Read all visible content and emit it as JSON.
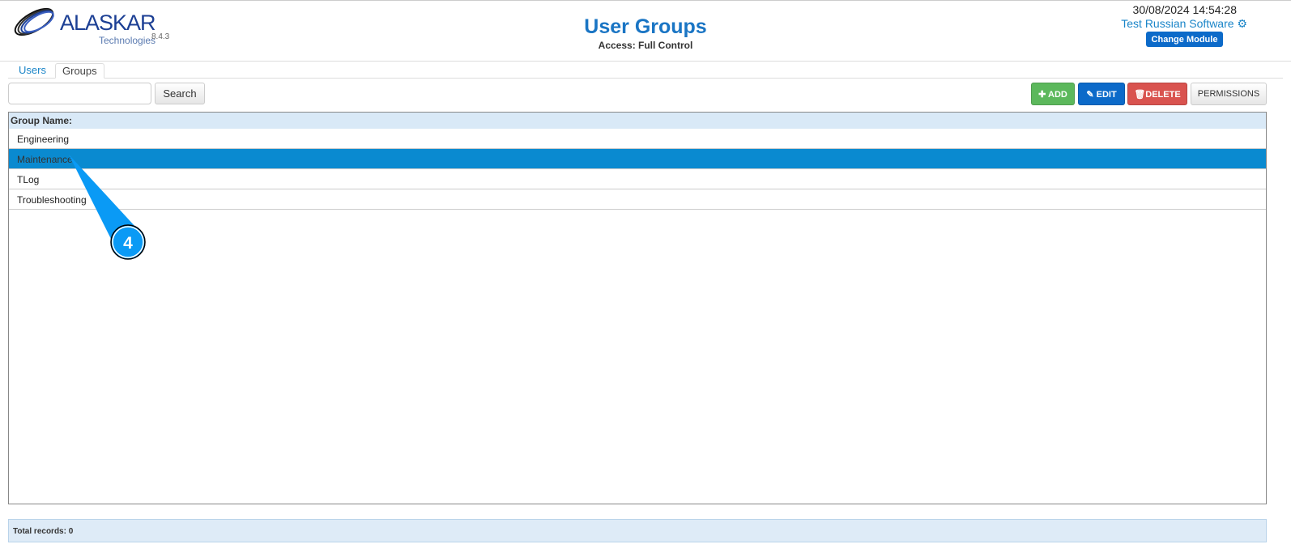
{
  "header": {
    "logo_text": "ALASKAR",
    "logo_sub": "Technologies",
    "version": "8.4.3",
    "title": "User Groups",
    "access": "Access: Full Control",
    "datetime": "30/08/2024 14:54:28",
    "company": "Test Russian Software",
    "change_module": "Change Module"
  },
  "tabs": [
    {
      "label": "Users"
    },
    {
      "label": "Groups"
    }
  ],
  "toolbar": {
    "search_value": "",
    "search_label": "Search",
    "add": "ADD",
    "edit": "EDIT",
    "delete": "DELETE",
    "permissions": "PERMISSIONS"
  },
  "grid": {
    "header": "Group Name:",
    "rows": [
      "Engineering",
      "Maintenance",
      "TLog",
      "Troubleshooting"
    ],
    "selected_index": 1
  },
  "footer": {
    "total": "Total records: 0"
  },
  "callout": {
    "number": "4"
  },
  "colors": {
    "accent": "#1a75c4",
    "selected": "#0a8ad0",
    "callout": "#0a9af5"
  }
}
